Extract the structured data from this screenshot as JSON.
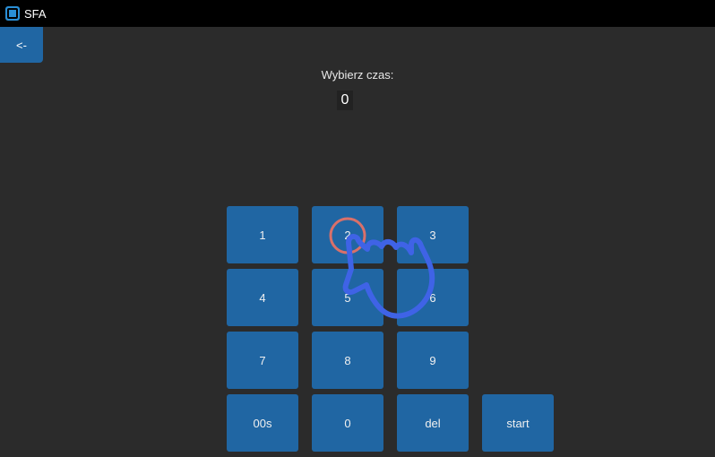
{
  "window": {
    "title": "SFA",
    "icon": "app-window-icon"
  },
  "nav": {
    "back_label": "<-"
  },
  "timer": {
    "prompt": "Wybierz czas:",
    "value": "0"
  },
  "keypad": {
    "k1": "1",
    "k2": "2",
    "k3": "3",
    "k4": "4",
    "k5": "5",
    "k6": "6",
    "k7": "7",
    "k8": "8",
    "k9": "9",
    "k00s": "00s",
    "k0": "0",
    "del": "del",
    "start": "start"
  },
  "colors": {
    "button": "#2066a3",
    "background": "#2b2b2b",
    "titlebar": "#000000",
    "tap_ring": "#d9706a",
    "hand": "#3f63e6"
  },
  "overlay": {
    "icon": "tap-hand-icon"
  }
}
